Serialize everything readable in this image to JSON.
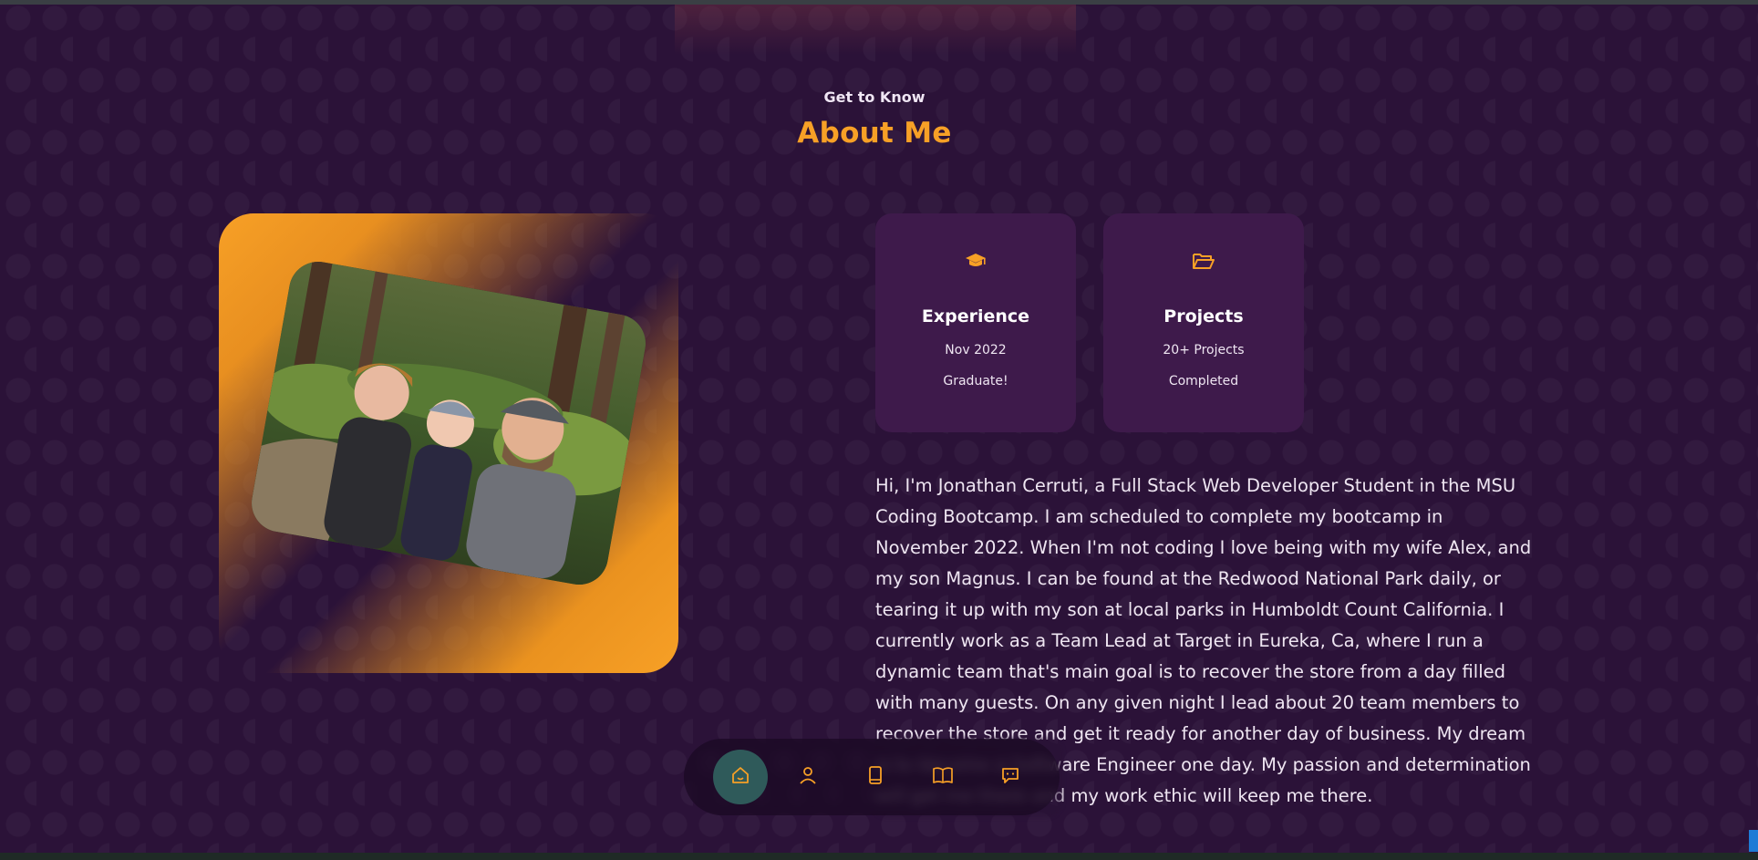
{
  "section": {
    "eyebrow": "Get to Know",
    "title": "About Me"
  },
  "photo": {
    "description_icon": "family-photo"
  },
  "cards": [
    {
      "icon": "graduation-cap-icon",
      "title": "Experience",
      "line1": "Nov 2022",
      "line2": "Graduate!"
    },
    {
      "icon": "folder-open-icon",
      "title": "Projects",
      "line1": "20+ Projects",
      "line2": "Completed"
    }
  ],
  "bio": "Hi, I'm Jonathan Cerruti, a Full Stack Web Developer Student in the MSU Coding Bootcamp. I am scheduled to complete my bootcamp in November 2022. When I'm not coding I love being with my wife Alex, and my son Magnus. I can be found at the Redwood National Park daily, or tearing it up with my son at local parks in Humboldt Count California. I currently work as a Team Lead at Target in Eureka, Ca, where I run a dynamic team that's main goal is to recover the store from a day filled with many guests. On any given night I lead about 20 team members to recover the store and get it ready for another day of business. My dream is to become a Software Engineer one day. My passion and determination will get me there and my work ethic will keep me there.",
  "nav": {
    "items": [
      {
        "icon": "home-icon",
        "active": true
      },
      {
        "icon": "user-icon",
        "active": false
      },
      {
        "icon": "book-icon",
        "active": false
      },
      {
        "icon": "open-book-icon",
        "active": false
      },
      {
        "icon": "message-icon",
        "active": false
      }
    ]
  },
  "colors": {
    "accent": "#f7a026",
    "background": "#2b1238",
    "card": "#3e1a4b",
    "nav_active": "#2f5a5a"
  }
}
